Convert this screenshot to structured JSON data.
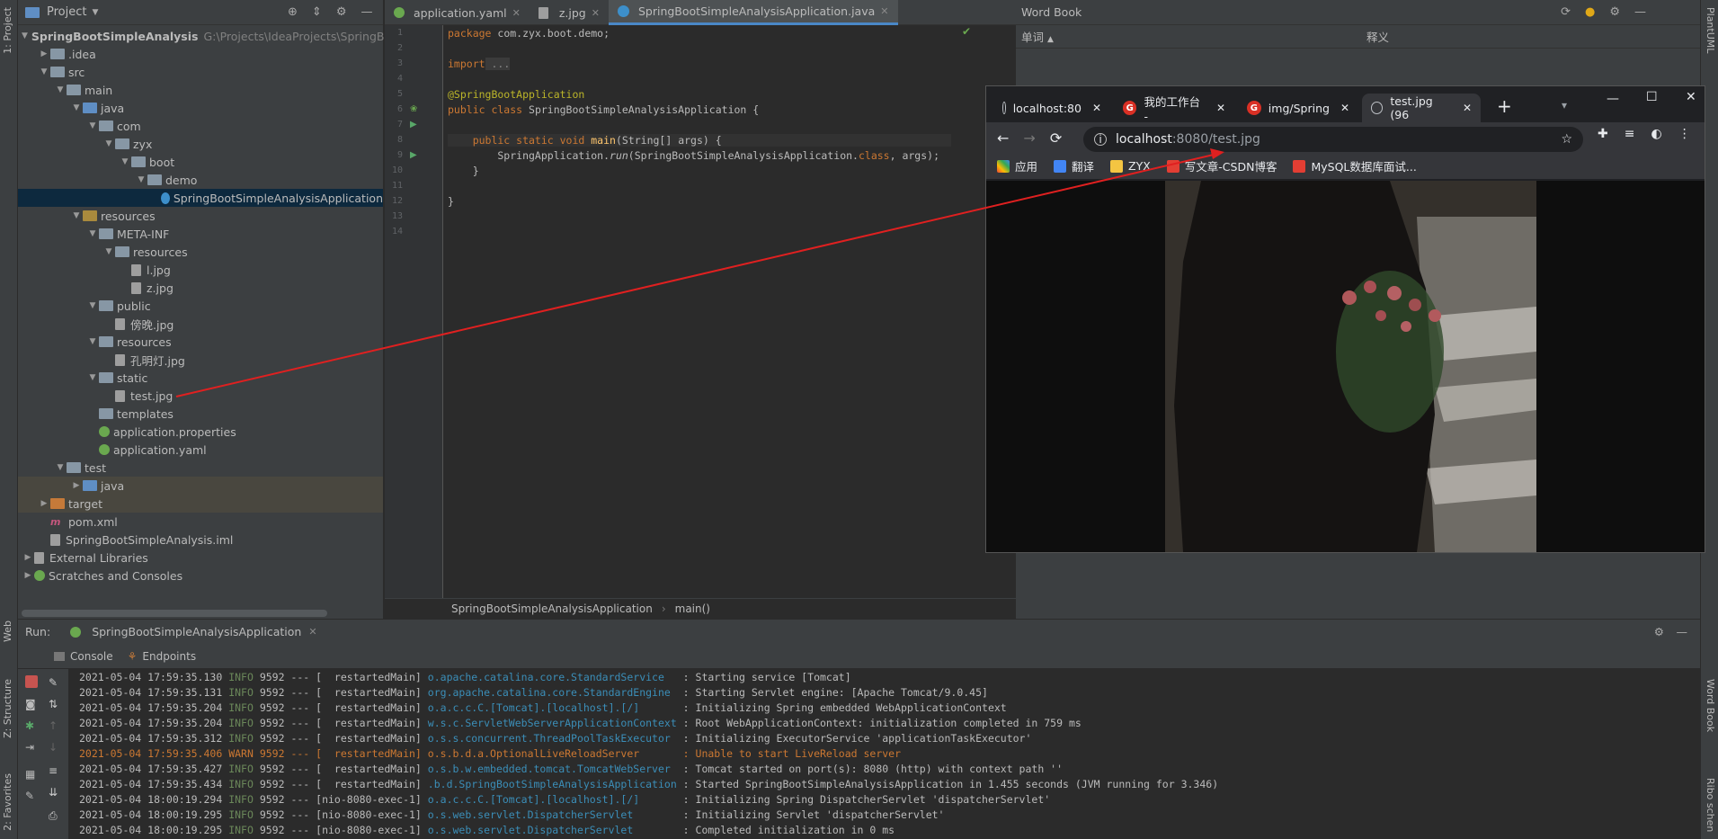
{
  "left_stripe": {
    "project_tab": "1: Project",
    "web_tab": "Web",
    "structure_tab": "Z: Structure",
    "favorites_tab": "2: Favorites"
  },
  "right_stripe": {
    "plantuml_tab": "PlantUML",
    "wordbook_tab": "Word Book",
    "ribbon_tab": "Ribo schen"
  },
  "project": {
    "title": "Project",
    "tree": [
      {
        "label": "SpringBootSimpleAnalysis",
        "hint": "G:\\Projects\\IdeaProjects\\SpringBootS",
        "depth": 0,
        "kind": "module",
        "open": true
      },
      {
        "label": ".idea",
        "depth": 1,
        "kind": "folder",
        "open": false
      },
      {
        "label": "src",
        "depth": 1,
        "kind": "folder",
        "open": true
      },
      {
        "label": "main",
        "depth": 2,
        "kind": "folder",
        "open": true
      },
      {
        "label": "java",
        "depth": 3,
        "kind": "src",
        "open": true
      },
      {
        "label": "com",
        "depth": 4,
        "kind": "folder",
        "open": true
      },
      {
        "label": "zyx",
        "depth": 5,
        "kind": "folder",
        "open": true
      },
      {
        "label": "boot",
        "depth": 6,
        "kind": "folder",
        "open": true
      },
      {
        "label": "demo",
        "depth": 7,
        "kind": "folder",
        "open": true
      },
      {
        "label": "SpringBootSimpleAnalysisApplication",
        "depth": 8,
        "kind": "class",
        "selected": true
      },
      {
        "label": "resources",
        "depth": 3,
        "kind": "res",
        "open": true
      },
      {
        "label": "META-INF",
        "depth": 4,
        "kind": "folder",
        "open": true
      },
      {
        "label": "resources",
        "depth": 5,
        "kind": "folder",
        "open": true
      },
      {
        "label": "l.jpg",
        "depth": 6,
        "kind": "file"
      },
      {
        "label": "z.jpg",
        "depth": 6,
        "kind": "file"
      },
      {
        "label": "public",
        "depth": 4,
        "kind": "folder",
        "open": true
      },
      {
        "label": "傍晚.jpg",
        "depth": 5,
        "kind": "file"
      },
      {
        "label": "resources",
        "depth": 4,
        "kind": "folder",
        "open": true
      },
      {
        "label": "孔明灯.jpg",
        "depth": 5,
        "kind": "file"
      },
      {
        "label": "static",
        "depth": 4,
        "kind": "folder",
        "open": true
      },
      {
        "label": "test.jpg",
        "depth": 5,
        "kind": "file"
      },
      {
        "label": "templates",
        "depth": 4,
        "kind": "folder"
      },
      {
        "label": "application.properties",
        "depth": 4,
        "kind": "spring"
      },
      {
        "label": "application.yaml",
        "depth": 4,
        "kind": "spring"
      },
      {
        "label": "test",
        "depth": 2,
        "kind": "folder",
        "open": true
      },
      {
        "label": "java",
        "depth": 3,
        "kind": "src",
        "open": false,
        "excluded": true
      },
      {
        "label": "target",
        "depth": 1,
        "kind": "orange",
        "open": false,
        "excluded": true
      },
      {
        "label": "pom.xml",
        "depth": 1,
        "kind": "maven"
      },
      {
        "label": "SpringBootSimpleAnalysis.iml",
        "depth": 1,
        "kind": "file"
      },
      {
        "label": "External Libraries",
        "depth": 0,
        "kind": "lib",
        "open": false
      },
      {
        "label": "Scratches and Consoles",
        "depth": 0,
        "kind": "scratch",
        "open": false
      }
    ]
  },
  "editor": {
    "tabs": [
      {
        "label": "application.yaml",
        "active": false
      },
      {
        "label": "z.jpg",
        "active": false
      },
      {
        "label": "SpringBootSimpleAnalysisApplication.java",
        "active": true
      }
    ],
    "line_numbers": [
      "1",
      "2",
      "3",
      "4",
      "5",
      "6",
      "7",
      "8",
      "9",
      "10",
      "11",
      "12",
      "13",
      "14"
    ],
    "code": {
      "l1_kw": "package",
      "l1_rest": " com.zyx.boot.demo;",
      "l3_kw": "import",
      "l3_rest": " ...",
      "l6": "@SpringBootApplication",
      "l7_kw": "public class",
      "l7_rest": " SpringBootSimpleAnalysisApplication {",
      "l9_kw": "    public static void",
      "l9_fn": " main",
      "l9_rest": "(String[] args) {",
      "l10_a": "        SpringApplication.",
      "l10_fn": "run",
      "l10_b": "(SpringBootSimpleAnalysisApplication.",
      "l10_kw": "class",
      "l10_c": ", args);",
      "l11": "    }",
      "l13": "}"
    },
    "breadcrumb": [
      "SpringBootSimpleAnalysisApplication",
      "main()"
    ]
  },
  "wordbook": {
    "title": "Word Book",
    "col_word": "单词",
    "col_meaning": "释义"
  },
  "browser": {
    "tabs": [
      {
        "label": "localhost:80"
      },
      {
        "label": "我的工作台 -"
      },
      {
        "label": "img/Spring"
      },
      {
        "label": "test.jpg (96"
      }
    ],
    "url_host": "localhost",
    "url_path": ":8080/test.jpg",
    "bookmarks": [
      "应用",
      "翻译",
      "ZYX",
      "写文章-CSDN博客",
      "MySQL数据库面试..."
    ]
  },
  "run": {
    "label": "Run:",
    "config": "SpringBootSimpleAnalysisApplication",
    "tabs": [
      "Console",
      "Endpoints"
    ],
    "logs": [
      {
        "ts": "2021-05-04 17:59:35.130",
        "lvl": "INFO",
        "pid": "9592",
        "thread": "[  restartedMain]",
        "cls": "o.apache.catalina.core.StandardService  ",
        "msg": "Starting service [Tomcat]"
      },
      {
        "ts": "2021-05-04 17:59:35.131",
        "lvl": "INFO",
        "pid": "9592",
        "thread": "[  restartedMain]",
        "cls": "org.apache.catalina.core.StandardEngine ",
        "msg": "Starting Servlet engine: [Apache Tomcat/9.0.45]"
      },
      {
        "ts": "2021-05-04 17:59:35.204",
        "lvl": "INFO",
        "pid": "9592",
        "thread": "[  restartedMain]",
        "cls": "o.a.c.c.C.[Tomcat].[localhost].[/]      ",
        "msg": "Initializing Spring embedded WebApplicationContext"
      },
      {
        "ts": "2021-05-04 17:59:35.204",
        "lvl": "INFO",
        "pid": "9592",
        "thread": "[  restartedMain]",
        "cls": "w.s.c.ServletWebServerApplicationContext",
        "msg": "Root WebApplicationContext: initialization completed in 759 ms"
      },
      {
        "ts": "2021-05-04 17:59:35.312",
        "lvl": "INFO",
        "pid": "9592",
        "thread": "[  restartedMain]",
        "cls": "o.s.s.concurrent.ThreadPoolTaskExecutor ",
        "msg": "Initializing ExecutorService 'applicationTaskExecutor'"
      },
      {
        "ts": "2021-05-04 17:59:35.406",
        "lvl": "WARN",
        "pid": "9592",
        "thread": "[  restartedMain]",
        "cls": "o.s.b.d.a.OptionalLiveReloadServer      ",
        "msg": "Unable to start LiveReload server",
        "warn": true
      },
      {
        "ts": "2021-05-04 17:59:35.427",
        "lvl": "INFO",
        "pid": "9592",
        "thread": "[  restartedMain]",
        "cls": "o.s.b.w.embedded.tomcat.TomcatWebServer ",
        "msg": "Tomcat started on port(s): 8080 (http) with context path ''"
      },
      {
        "ts": "2021-05-04 17:59:35.434",
        "lvl": "INFO",
        "pid": "9592",
        "thread": "[  restartedMain]",
        "cls": ".b.d.SpringBootSimpleAnalysisApplication",
        "msg": "Started SpringBootSimpleAnalysisApplication in 1.455 seconds (JVM running for 3.346)"
      },
      {
        "ts": "2021-05-04 18:00:19.294",
        "lvl": "INFO",
        "pid": "9592",
        "thread": "[nio-8080-exec-1]",
        "cls": "o.a.c.c.C.[Tomcat].[localhost].[/]      ",
        "msg": "Initializing Spring DispatcherServlet 'dispatcherServlet'"
      },
      {
        "ts": "2021-05-04 18:00:19.295",
        "lvl": "INFO",
        "pid": "9592",
        "thread": "[nio-8080-exec-1]",
        "cls": "o.s.web.servlet.DispatcherServlet       ",
        "msg": "Initializing Servlet 'dispatcherServlet'"
      },
      {
        "ts": "2021-05-04 18:00:19.295",
        "lvl": "INFO",
        "pid": "9592",
        "thread": "[nio-8080-exec-1]",
        "cls": "o.s.web.servlet.DispatcherServlet       ",
        "msg": "Completed initialization in 0 ms"
      }
    ]
  },
  "annotation_color": "#e02020"
}
